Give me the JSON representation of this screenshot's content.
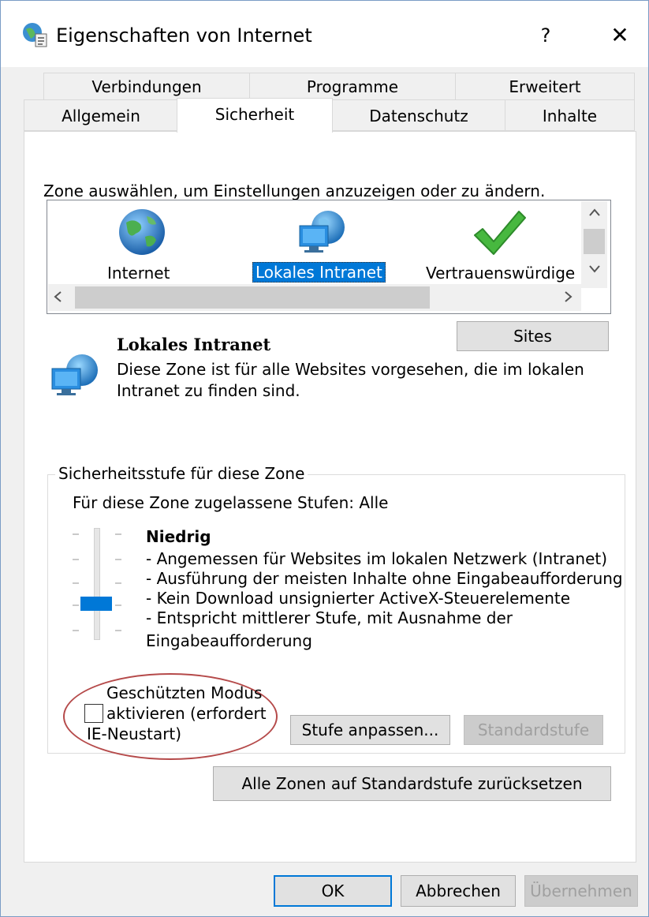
{
  "window": {
    "title": "Eigenschaften von Internet",
    "help": "?",
    "close": "✕"
  },
  "tabs": {
    "top": [
      "Verbindungen",
      "Programme",
      "Erweitert"
    ],
    "bottom": [
      "Allgemein",
      "Sicherheit",
      "Datenschutz",
      "Inhalte"
    ],
    "active": "Sicherheit"
  },
  "zones": {
    "prompt": "Zone auswählen, um Einstellungen anzuzeigen oder zu ändern.",
    "items": [
      {
        "label": "Internet",
        "icon": "globe-icon"
      },
      {
        "label": "Lokales Intranet",
        "icon": "intranet-icon"
      },
      {
        "label": "Vertrauenswürdige",
        "icon": "checkmark-icon"
      }
    ],
    "selected": "Lokales Intranet",
    "sites_button": "Sites"
  },
  "zone_info": {
    "title": "Lokales Intranet",
    "description_line1": "Diese Zone ist für alle Websites vorgesehen, die im lokalen",
    "description_line2": "Intranet zu finden sind."
  },
  "security_level": {
    "group_title": "Sicherheitsstufe für diese Zone",
    "allowed": "Für diese Zone zugelassene Stufen: Alle",
    "level_name": "Niedrig",
    "lines": [
      "- Angemessen für Websites im lokalen Netzwerk (Intranet)",
      "- Ausführung der meisten Inhalte ohne Eingabeaufforderung",
      "- Kein Download unsignierter ActiveX-Steuerelemente",
      "- Entspricht mittlerer Stufe, mit Ausnahme der",
      "Eingabeaufforderung"
    ],
    "protected_mode_line1": "Geschützten Modus",
    "protected_mode_line2": "aktivieren (erfordert",
    "protected_mode_line3": "IE-Neustart)",
    "protected_mode_checked": false,
    "custom_level_button": "Stufe anpassen...",
    "default_level_button": "Standardstufe"
  },
  "reset_all_button": "Alle Zonen auf Standardstufe zurücksetzen",
  "footer": {
    "ok": "OK",
    "cancel": "Abbrechen",
    "apply": "Übernehmen"
  },
  "colors": {
    "accent": "#0078d7",
    "annotation": "#b54a4a"
  }
}
